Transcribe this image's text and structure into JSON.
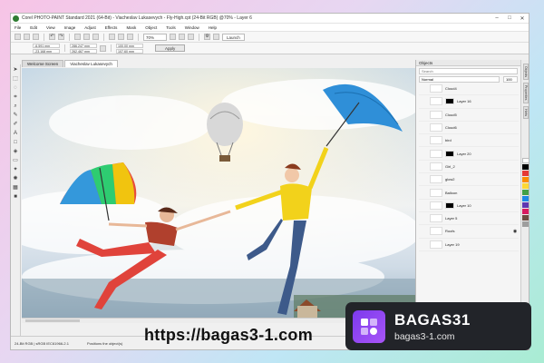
{
  "window": {
    "title": "Corel PHOTO-PAINT Standard 2021 (64-Bit) - Viacheslav Lukasevych - Fly-High.cpt (24-Bit RGB) @70% - Layer 6",
    "controls": [
      "–",
      "□",
      "✕"
    ]
  },
  "menu": [
    "File",
    "Edit",
    "View",
    "Image",
    "Adjust",
    "Effects",
    "Mask",
    "Object",
    "Tools",
    "Window",
    "Help"
  ],
  "toolbar": {
    "zoom_value": "70%",
    "launch_label": "Launch"
  },
  "property_bar": {
    "x": "-6.591 mm",
    "y": "-23.168 mm",
    "w": "286.247 mm",
    "h": "262.467 mm",
    "sx": "100.00 mm",
    "sy": "107.60 mm",
    "apply_label": "Apply"
  },
  "doc_tabs": [
    "Welcome Screen",
    "Viacheslav Lukasevych"
  ],
  "objects_panel": {
    "title": "Objects",
    "search_placeholder": "Search",
    "blend_mode": "Normal",
    "opacity": "100",
    "layers": [
      {
        "name": "Cloud4",
        "mask": false,
        "eye": ""
      },
      {
        "name": "Layer 16",
        "mask": true,
        "eye": ""
      },
      {
        "name": "Cloud5",
        "mask": false,
        "eye": ""
      },
      {
        "name": "Cloud6",
        "mask": false,
        "eye": ""
      },
      {
        "name": "bird",
        "mask": false,
        "eye": ""
      },
      {
        "name": "Layer 20",
        "mask": true,
        "eye": ""
      },
      {
        "name": "Girl_2",
        "mask": false,
        "eye": ""
      },
      {
        "name": "glow2",
        "mask": false,
        "eye": ""
      },
      {
        "name": "Balloon",
        "mask": false,
        "eye": ""
      },
      {
        "name": "Layer 10",
        "mask": true,
        "eye": ""
      },
      {
        "name": "Layer 5",
        "mask": false,
        "eye": ""
      },
      {
        "name": "Roofs",
        "mask": false,
        "eye": "◉"
      },
      {
        "name": "Layer 19",
        "mask": false,
        "eye": ""
      }
    ]
  },
  "side_tabs": [
    "Objects",
    "Properties",
    "Hints"
  ],
  "status": {
    "color_info": "24-Bit RGB | sRGB IEC61966-2.1",
    "hint": "Positions the object(s)"
  },
  "watermark": {
    "url": "https://bagas3-1.com",
    "brand": "BAGAS31",
    "domain": "bagas3-1.com"
  },
  "colors": {
    "accent": "#7c3aed",
    "umbrella_blue": "#2f8fd8",
    "shirt_yellow": "#f2d21b",
    "pants_red": "#e0433b"
  }
}
